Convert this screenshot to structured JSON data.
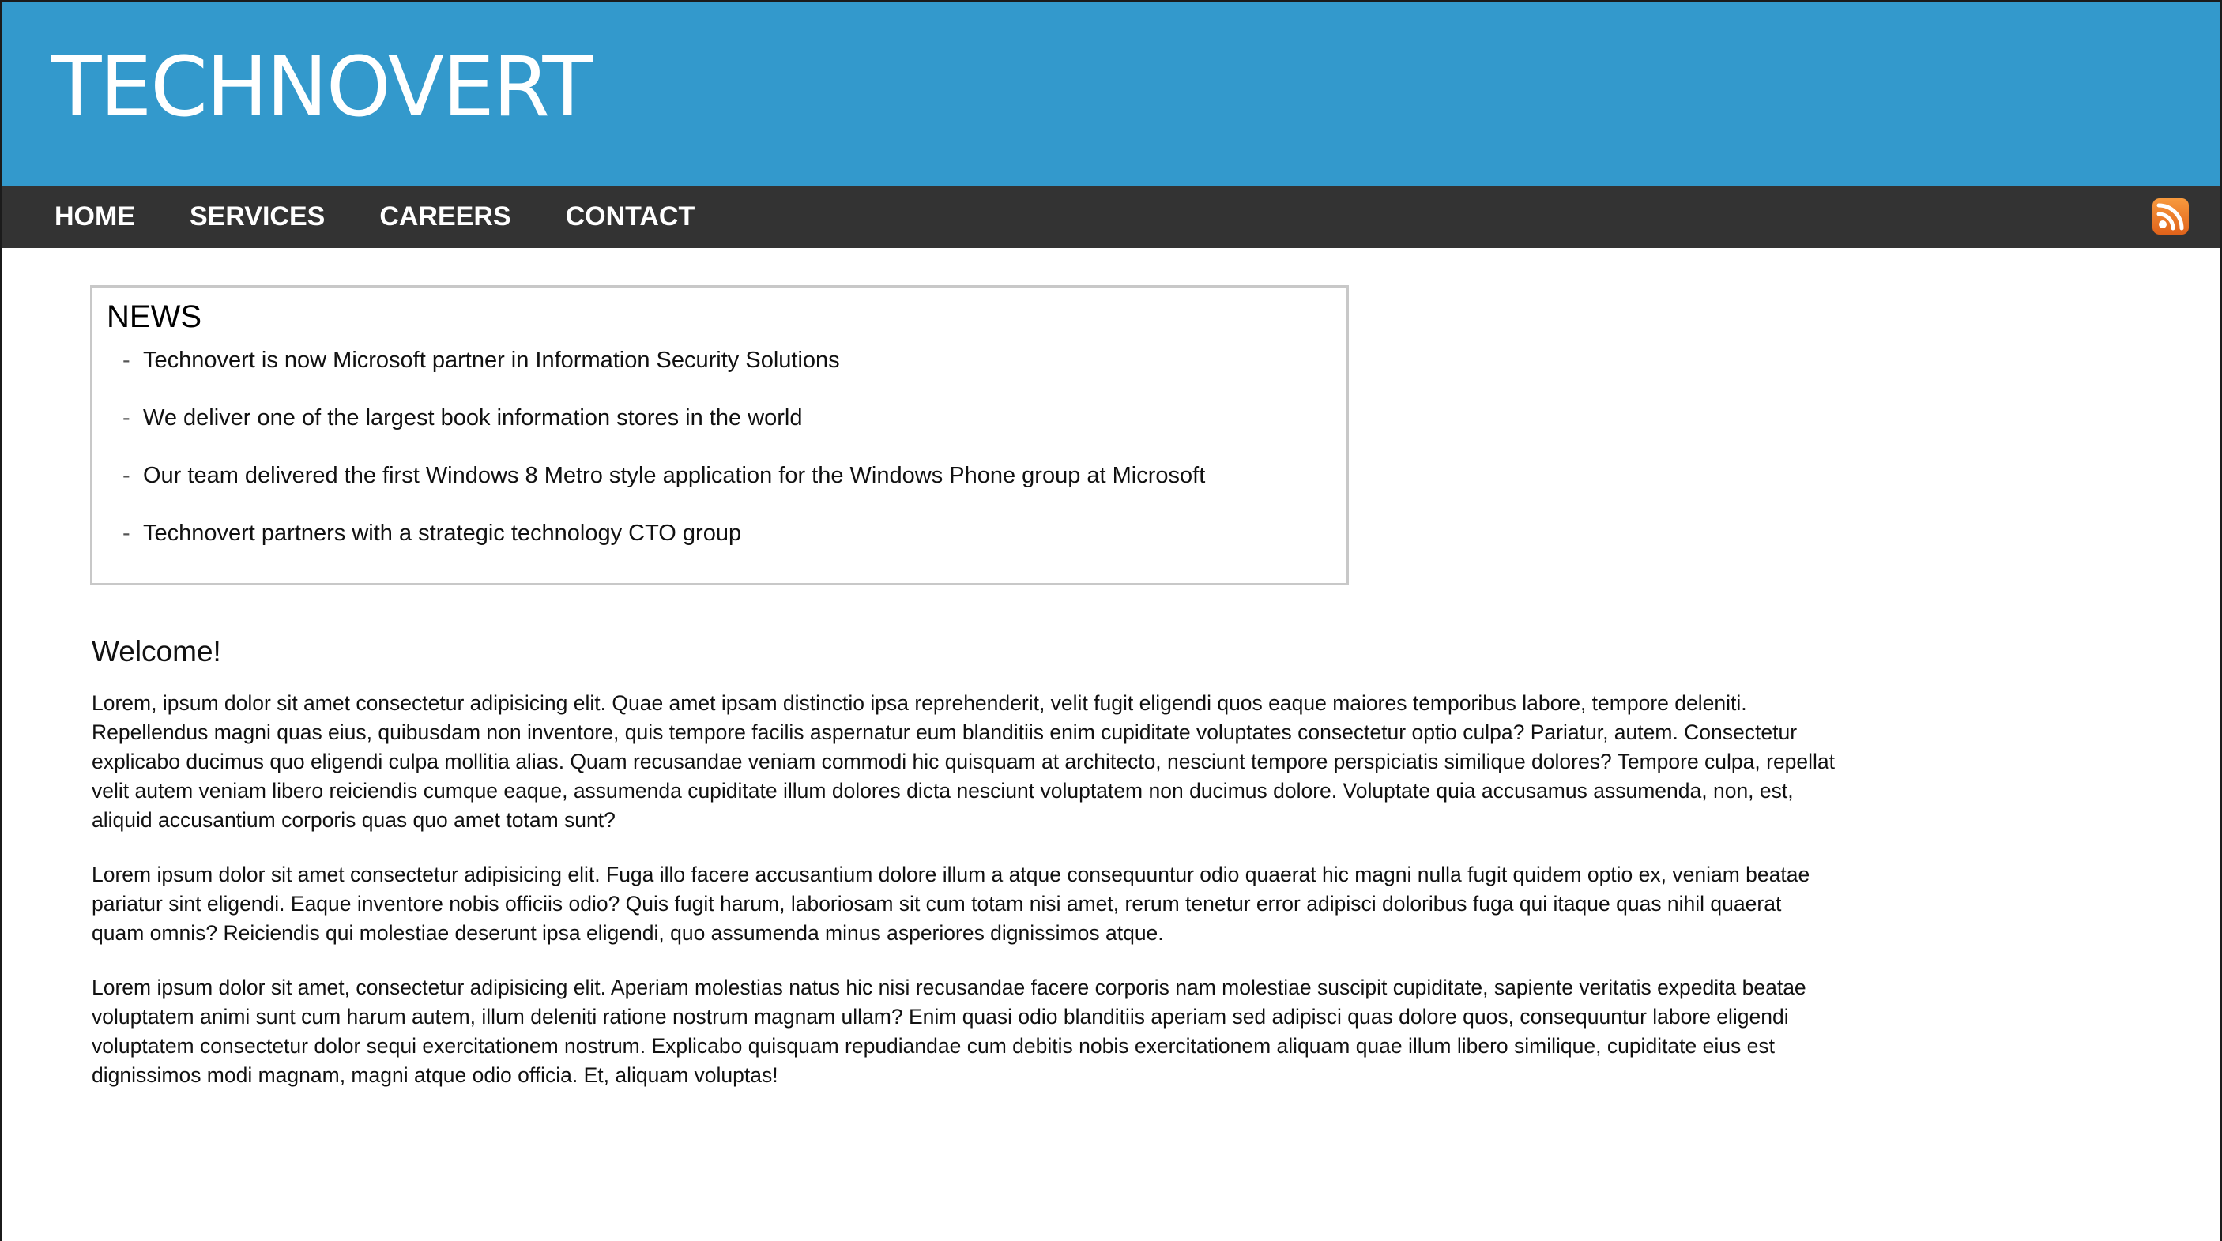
{
  "header": {
    "brand": "TECHNOVERT",
    "background_color": "#3399cc"
  },
  "nav": {
    "items": [
      {
        "label": "HOME"
      },
      {
        "label": "SERVICES"
      },
      {
        "label": "CAREERS"
      },
      {
        "label": "CONTACT"
      }
    ],
    "rss_icon": "rss-feed-icon",
    "background_color": "#333333"
  },
  "news": {
    "title": "NEWS",
    "items": [
      {
        "text": "Technovert is now Microsoft partner in Information Security Solutions"
      },
      {
        "text": "We deliver one of the largest book information stores in the world"
      },
      {
        "text": "Our team delivered the first Windows 8 Metro style application for the Windows Phone group at Microsoft"
      },
      {
        "text": "Technovert partners with a strategic technology CTO group"
      }
    ]
  },
  "main": {
    "heading": "Welcome!",
    "paragraphs": [
      "Lorem, ipsum dolor sit amet consectetur adipisicing elit. Quae amet ipsam distinctio ipsa reprehenderit, velit fugit eligendi quos eaque maiores temporibus labore, tempore deleniti. Repellendus magni quas eius, quibusdam non inventore, quis tempore facilis aspernatur eum blanditiis enim cupiditate voluptates consectetur optio culpa? Pariatur, autem. Consectetur explicabo ducimus quo eligendi culpa mollitia alias. Quam recusandae veniam commodi hic quisquam at architecto, nesciunt tempore perspiciatis similique dolores? Tempore culpa, repellat velit autem veniam libero reiciendis cumque eaque, assumenda cupiditate illum dolores dicta nesciunt voluptatem non ducimus dolore. Voluptate quia accusamus assumenda, non, est, aliquid accusantium corporis quas quo amet totam sunt?",
      "Lorem ipsum dolor sit amet consectetur adipisicing elit. Fuga illo facere accusantium dolore illum a atque consequuntur odio quaerat hic magni nulla fugit quidem optio ex, veniam beatae pariatur sint eligendi. Eaque inventore nobis officiis odio? Quis fugit harum, laboriosam sit cum totam nisi amet, rerum tenetur error adipisci doloribus fuga qui itaque quas nihil quaerat quam omnis? Reiciendis qui molestiae deserunt ipsa eligendi, quo assumenda minus asperiores dignissimos atque.",
      "Lorem ipsum dolor sit amet, consectetur adipisicing elit. Aperiam molestias natus hic nisi recusandae facere corporis nam molestiae suscipit cupiditate, sapiente veritatis expedita beatae voluptatem animi sunt cum harum autem, illum deleniti ratione nostrum magnam ullam? Enim quasi odio blanditiis aperiam sed adipisci quas dolore quos, consequuntur labore eligendi voluptatem consectetur dolor sequi exercitationem nostrum. Explicabo quisquam repudiandae cum debitis nobis exercitationem aliquam quae illum libero similique, cupiditate eius est dignissimos modi magnam, magni atque odio officia. Et, aliquam voluptas!"
    ]
  }
}
